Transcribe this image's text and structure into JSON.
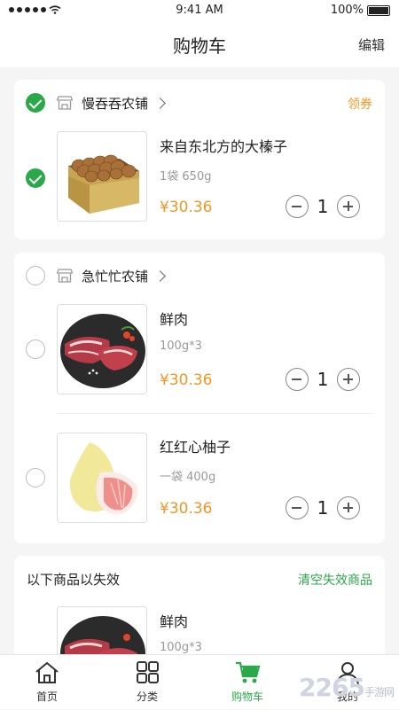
{
  "status_bar": {
    "time": "9:41 AM",
    "battery": "100%"
  },
  "header": {
    "title": "购物车",
    "edit_label": "编辑"
  },
  "shops": [
    {
      "name": "慢吞吞农铺",
      "checked": true,
      "coupon_label": "领券",
      "items": [
        {
          "name": "来自东北方的大榛子",
          "spec": "1袋 650g",
          "price": "¥30.36",
          "qty": "1",
          "checked": true,
          "image": "hazelnut-box"
        }
      ]
    },
    {
      "name": "急忙忙农铺",
      "checked": false,
      "items": [
        {
          "name": "鲜肉",
          "spec": "100g*3",
          "price": "¥30.36",
          "qty": "1",
          "checked": false,
          "image": "fresh-meat"
        },
        {
          "name": "红红心柚子",
          "spec": "一袋 400g",
          "price": "¥30.36",
          "qty": "1",
          "checked": false,
          "image": "pomelo"
        }
      ]
    }
  ],
  "invalid": {
    "title": "以下商品以失效",
    "clear_label": "清空失效商品",
    "items": [
      {
        "name": "鲜肉",
        "spec": "100g*3",
        "image": "fresh-meat"
      }
    ]
  },
  "tabbar": [
    {
      "label": "首页",
      "icon": "home-icon"
    },
    {
      "label": "分类",
      "icon": "grid-icon"
    },
    {
      "label": "购物车",
      "icon": "cart-icon",
      "active": true
    },
    {
      "label": "我的",
      "icon": "user-icon"
    }
  ],
  "watermark": {
    "brand": "2265",
    "sub": "手游网"
  },
  "colors": {
    "accent_green": "#2aa84a",
    "price_orange": "#f29623"
  }
}
